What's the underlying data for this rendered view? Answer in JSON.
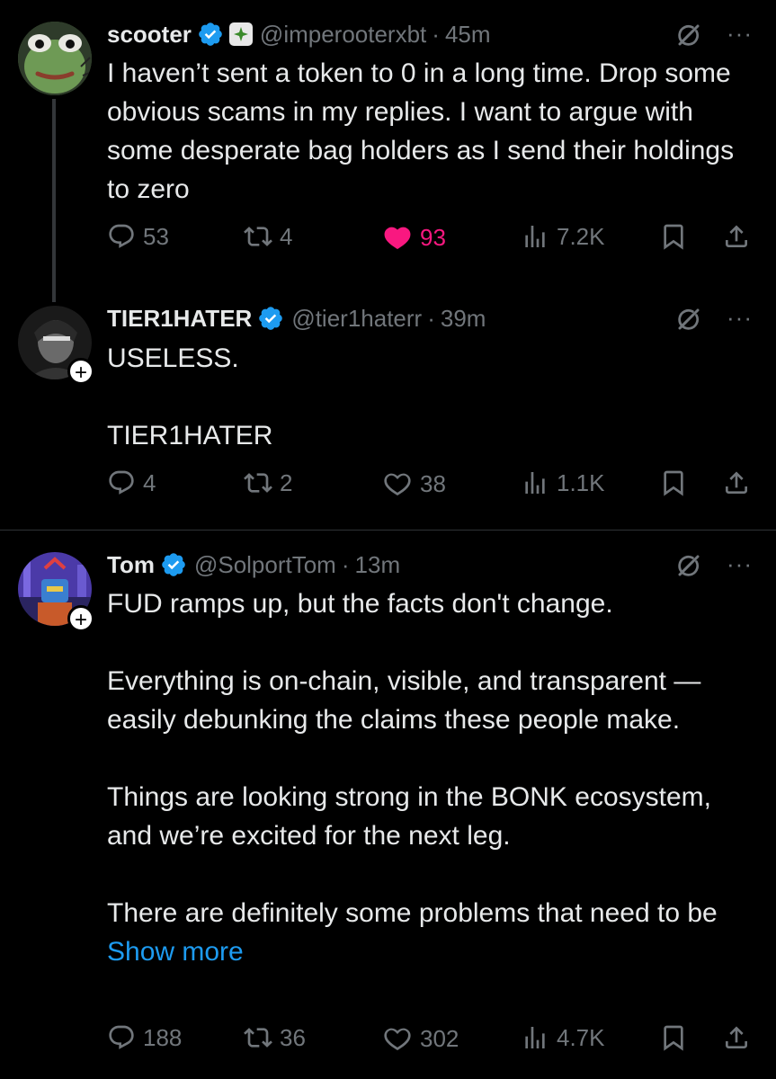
{
  "tweets": [
    {
      "name": "scooter",
      "handle": "@imperooterxbt",
      "sep": "·",
      "time": "45m",
      "text": "I haven’t sent a token to 0 in a long time. Drop some obvious scams in my replies. I want to argue with some desperate bag holders as I send their holdings to zero",
      "replies": "53",
      "reposts": "4",
      "likes": "93",
      "views": "7.2K",
      "liked": true
    },
    {
      "name": "TIER1HATER",
      "handle": "@tier1haterr",
      "sep": "·",
      "time": "39m",
      "text": "USELESS.\n\nTIER1HATER",
      "replies": "4",
      "reposts": "2",
      "likes": "38",
      "views": "1.1K",
      "liked": false
    },
    {
      "name": "Tom",
      "handle": "@SolportTom",
      "sep": "·",
      "time": "13m",
      "text": "FUD ramps up, but the facts don't change.\n\nEverything is on-chain, visible, and transparent — easily debunking the claims these people make.\n\nThings are looking strong in the BONK ecosystem, and we’re excited for the next leg.\n\nThere are definitely some problems that need to be ",
      "show_more": "Show more",
      "replies": "188",
      "reposts": "36",
      "likes": "302",
      "views": "4.7K",
      "liked": false
    }
  ],
  "ui": {
    "more": "···"
  },
  "colors": {
    "background": "#000000",
    "text": "#e7e9ea",
    "muted": "#71767b",
    "verified": "#1d9bf0",
    "like": "#f91880",
    "divider": "#2f3336"
  },
  "icons": [
    "verified-badge-icon",
    "affiliate-badge-icon",
    "grok-icon",
    "more-icon",
    "reply-icon",
    "repost-icon",
    "like-icon",
    "views-icon",
    "bookmark-icon",
    "share-icon",
    "follow-plus-icon"
  ]
}
